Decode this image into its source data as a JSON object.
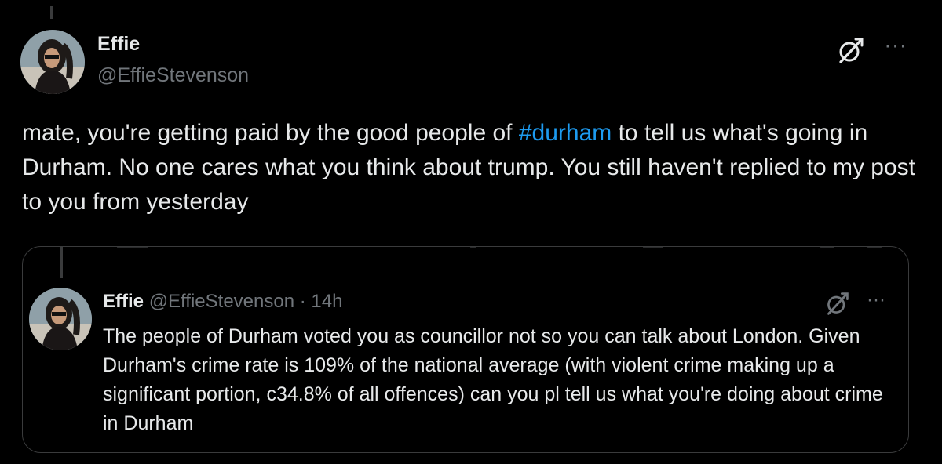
{
  "tweet": {
    "author_name": "Effie",
    "author_handle": "@EffieStevenson",
    "text_before": "mate, you're getting paid by the good people of ",
    "hashtag": "#durham",
    "text_after": " to tell us what's going in Durham. No one cares what you think about trump. You still haven't replied to my post to you from yesterday"
  },
  "quoted_tweet": {
    "author_name": "Effie",
    "author_handle": "@EffieStevenson",
    "separator": "·",
    "time": "14h",
    "text": "The people of Durham voted you as councillor not so you can talk about London. Given Durham's crime rate is 109% of the national average (with violent crime making up a significant portion, c34.8% of all offences) can you pl tell us what you're doing about crime in Durham"
  },
  "icons": {
    "grok": "grok-icon",
    "more": "more-icon",
    "more_glyph": "···"
  },
  "colors": {
    "background": "#000000",
    "text": "#e7e9ea",
    "secondary": "#71767b",
    "link": "#1d9bf0",
    "border": "#3a3b3c"
  }
}
